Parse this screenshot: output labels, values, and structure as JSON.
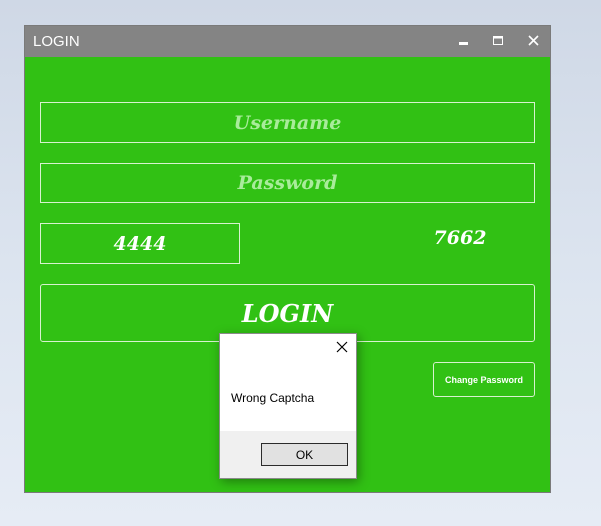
{
  "window": {
    "title": "LOGIN",
    "minimize_icon": "minimize-icon",
    "maximize_icon": "maximize-icon",
    "close_icon": "close-icon"
  },
  "form": {
    "username_placeholder": "Username",
    "password_placeholder": "Password",
    "captcha_input_value": "4444",
    "captcha_code": "7662",
    "login_label": "LOGIN",
    "change_password_label": "Change Password"
  },
  "dialog": {
    "message": "Wrong Captcha",
    "ok_label": "OK",
    "close_icon": "close-icon"
  },
  "colors": {
    "background": "#31c114",
    "titlebar": "#848484",
    "placeholder_text": "#a9ec9b",
    "border": "#d7f2cf",
    "dialog_footer": "#f0f0f0"
  }
}
